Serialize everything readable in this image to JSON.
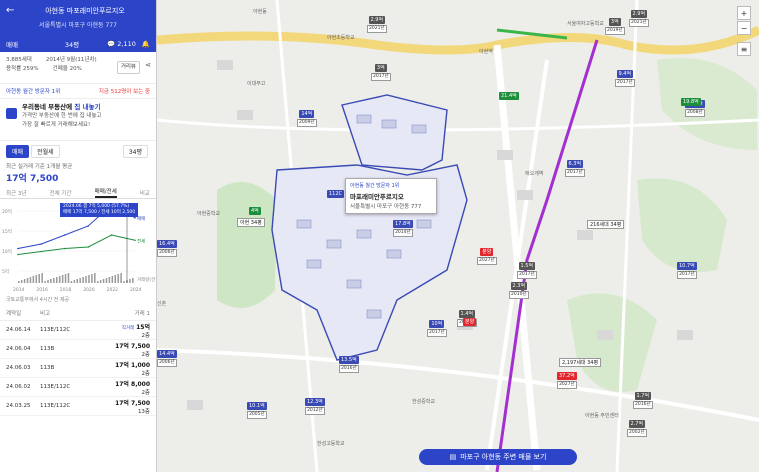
{
  "panel": {
    "title": "아현동 마포래미안푸르지오",
    "address": "서울특별시 마포구 아현동 777",
    "tabs": {
      "sale": "매매",
      "size": "34평",
      "comments": "2,110"
    },
    "info": {
      "households": "3,885세대",
      "date": "2014년 9월(11년차)",
      "far": "용적률 259%",
      "bcr": "건폐율 20%",
      "distance_btn": "거리뷰"
    },
    "rank": {
      "label": "아현동 월간 방문자 1위",
      "notice": "지금 512명이 보는 중"
    },
    "promo": {
      "title_a": "우리동네 부동산에 ",
      "title_b": "집 내놓기",
      "line1": "가격만 부동산에 한 번에 집 내놓고",
      "line2": "가장 잘 빠르게 거래해보세요!"
    },
    "chips": {
      "sale": "매매",
      "jeonse": "전월세",
      "size_select": "34평"
    },
    "avg_label": "최근 실거래 기준 1개월 평균",
    "avg_price": "17억 7,500",
    "range_tabs": [
      "최근 3년",
      "전체 기간",
      "매매/전세",
      "비교"
    ],
    "tooltip": {
      "line1": "2024.06 갭 7억 5,000 (57.7%)",
      "line2": "매매 17억 7,500 / 전세 10억 2,500"
    },
    "y_labels": [
      "20억",
      "15억",
      "10억",
      "5억",
      "0",
      "1",
      "2"
    ],
    "x_labels": [
      "2014",
      "2016",
      "2018",
      "2020",
      "2022",
      "2024"
    ],
    "side_labels": {
      "sale": "매매",
      "jeonse": "전세",
      "volume": "거래량(건)"
    },
    "source": "국토교통부에서 4시간 전 제공",
    "table": {
      "headers": [
        "계약일",
        "비고",
        "가격"
      ],
      "rows": [
        {
          "date": "24.06.14",
          "note": "113E/112C",
          "badge": "직거래",
          "price": "15억",
          "floor": "2층"
        },
        {
          "date": "24.06.04",
          "note": "113B",
          "badge": "",
          "price": "17억 7,500",
          "floor": "2층"
        },
        {
          "date": "24.06.03",
          "note": "113B",
          "badge": "",
          "price": "17억 1,000",
          "floor": "2층"
        },
        {
          "date": "24.06.02",
          "note": "113E/112C",
          "badge": "",
          "price": "17억 8,000",
          "floor": "2층"
        },
        {
          "date": "24.03.25",
          "note": "113E/112C",
          "badge": "",
          "price": "17억 7,500",
          "floor": "13층"
        }
      ],
      "top_suffix": "거래 1"
    },
    "chart_data": {
      "type": "line",
      "x": [
        "2014",
        "2016",
        "2018",
        "2020",
        "2022",
        "2024"
      ],
      "series": [
        {
          "name": "매매",
          "values": [
            7.5,
            9,
            12,
            15,
            22,
            17.75
          ]
        },
        {
          "name": "전세",
          "values": [
            5.5,
            6.5,
            7.5,
            8,
            12,
            10.25
          ]
        }
      ],
      "ylim": [
        0,
        20
      ]
    }
  },
  "map": {
    "popup": {
      "rank": "아현동 월간 방문자 1위",
      "name": "마포래미안푸르지오",
      "address": "서울특별시 마포구 아현동 777"
    },
    "bottom_button": "마포구 아현동 주변 매물 보기",
    "place_labels": [
      "아현동",
      "아현역",
      "애오개역",
      "아현초등학교",
      "한성중학교",
      "한성고등학교",
      "서울여자고등학교",
      "아현중학교",
      "이대부고",
      "아현동 주민센터",
      "신촌"
    ],
    "markers": [
      {
        "price": "14억",
        "year": "2009년",
        "c": "navy"
      },
      {
        "price": "112C",
        "year": "",
        "c": "navy"
      },
      {
        "price": "17.8억",
        "year": "2014년",
        "c": "navy"
      },
      {
        "price": "13.5억",
        "year": "2016년",
        "c": "navy"
      },
      {
        "price": "16.4억",
        "year": "2006년",
        "c": "navy"
      },
      {
        "price": "14.4억",
        "year": "2006년",
        "c": "navy"
      },
      {
        "price": "10.1억",
        "year": "2005년",
        "c": "navy"
      },
      {
        "price": "12.3억",
        "year": "2012년",
        "c": "navy"
      },
      {
        "price": "10억",
        "year": "2017년",
        "c": "navy"
      },
      {
        "price": "6.3억",
        "year": "2017년",
        "c": "navy"
      },
      {
        "price": "9.4억",
        "year": "2017년",
        "c": "navy"
      },
      {
        "price": "16.4억",
        "year": "2008년",
        "c": "navy"
      },
      {
        "price": "10.7억",
        "year": "2017년",
        "c": "navy"
      },
      {
        "price": "2.9억",
        "year": "2021년",
        "c": "gray"
      },
      {
        "price": "1.4억",
        "year": "2016년",
        "c": "gray"
      },
      {
        "price": "2.3억",
        "year": "2010년",
        "c": "gray"
      },
      {
        "price": "3억",
        "year": "2019년",
        "c": "gray"
      },
      {
        "price": "3억",
        "year": "2017년",
        "c": "gray"
      },
      {
        "price": "1.5억",
        "year": "2017년",
        "c": "gray"
      },
      {
        "price": "2.9억",
        "year": "2021년",
        "c": "gray"
      },
      {
        "price": "1.7억",
        "year": "2016년",
        "c": "gray"
      },
      {
        "price": "2.7억",
        "year": "2002년",
        "c": "gray"
      },
      {
        "price": "분양",
        "year": "2027년",
        "c": "rd"
      },
      {
        "price": "37.2억",
        "year": "2027년",
        "c": "rd"
      },
      {
        "price": "분양",
        "year": "",
        "c": "rd"
      },
      {
        "price": "4억",
        "year": "",
        "c": "grn"
      },
      {
        "price": "21.4억",
        "year": "",
        "c": "grn"
      },
      {
        "price": "19.8억",
        "year": "",
        "c": "grn"
      }
    ],
    "tags": [
      "216세대 34평",
      "2,197세대 34평",
      "아현 34평"
    ]
  },
  "colors": {
    "brand": "#2c45c8",
    "sale_line": "#2c45c8",
    "jeonse_line": "#1d8f3c",
    "red": "#e2262b"
  }
}
